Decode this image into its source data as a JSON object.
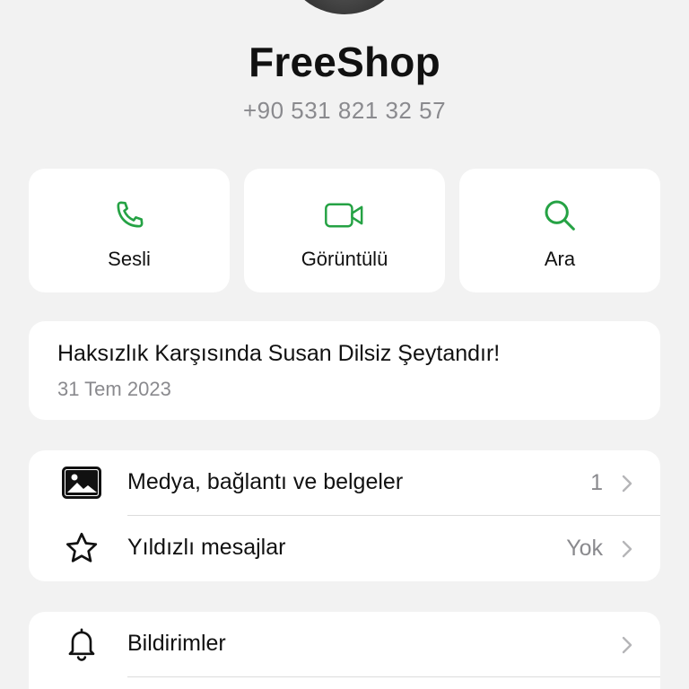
{
  "contact": {
    "name": "FreeShop",
    "phone": "+90 531 821 32 57"
  },
  "actions": [
    {
      "label": "Sesli",
      "icon": "phone-icon"
    },
    {
      "label": "Görüntülü",
      "icon": "video-icon"
    },
    {
      "label": "Ara",
      "icon": "search-icon"
    }
  ],
  "about": {
    "text": "Haksızlık Karşısında Susan Dilsiz Şeytandır!",
    "date": "31 Tem 2023"
  },
  "media_group": {
    "items": [
      {
        "label": "Medya, bağlantı ve belgeler",
        "value": "1",
        "icon": "image-icon"
      },
      {
        "label": "Yıldızlı mesajlar",
        "value": "Yok",
        "icon": "star-icon"
      }
    ]
  },
  "settings_group": {
    "items": [
      {
        "label": "Bildirimler",
        "icon": "bell-icon"
      }
    ]
  },
  "colors": {
    "accent": "#25a244",
    "background": "#f2f2f2",
    "card": "#ffffff",
    "secondary_text": "#8a8a8e"
  }
}
